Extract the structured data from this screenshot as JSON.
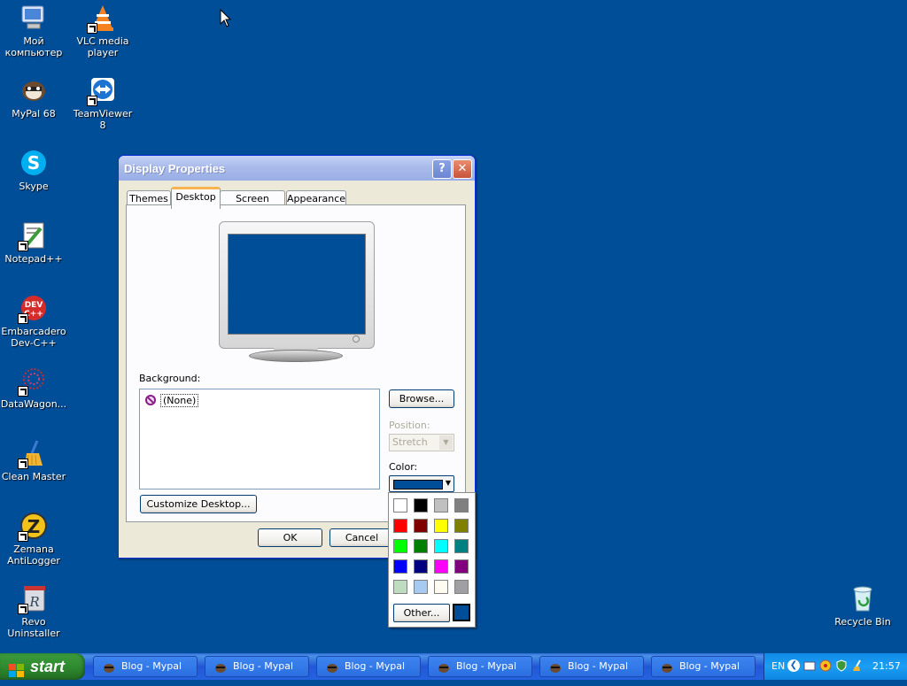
{
  "desktop": {
    "background_color": "#004e98",
    "icons": [
      {
        "label": "Мой компьютер",
        "icon": "my-computer-icon"
      },
      {
        "label": "VLC media player",
        "icon": "vlc-icon"
      },
      {
        "label": "MyPal 68",
        "icon": "mypal-icon"
      },
      {
        "label": "TeamViewer 8",
        "icon": "teamviewer-icon"
      },
      {
        "label": "Skype",
        "icon": "skype-icon"
      },
      {
        "label": "Notepad++",
        "icon": "notepadpp-icon"
      },
      {
        "label": "Embarcadero Dev-C++",
        "icon": "devcpp-icon"
      },
      {
        "label": "DataWagon...",
        "icon": "datawagon-icon"
      },
      {
        "label": "Clean Master",
        "icon": "clean-master-icon"
      },
      {
        "label": "Zemana AntiLogger",
        "icon": "zemana-icon"
      },
      {
        "label": "Revo Uninstaller",
        "icon": "revo-icon"
      },
      {
        "label": "Recycle Bin",
        "icon": "recycle-bin-icon"
      }
    ]
  },
  "dialog": {
    "title": "Display Properties",
    "help_label": "?",
    "close_label": "✕",
    "tabs": [
      {
        "label": "Themes",
        "active": false
      },
      {
        "label": "Desktop",
        "active": true
      },
      {
        "label": "Screen Saver",
        "active": false
      },
      {
        "label": "Appearance",
        "active": false
      }
    ],
    "background_label": "Background:",
    "background_items": [
      {
        "label": "(None)",
        "selected": true
      }
    ],
    "browse_label": "Browse...",
    "position_label": "Position:",
    "position_value": "Stretch",
    "color_label": "Color:",
    "selected_color": "#004e98",
    "customize_label": "Customize Desktop...",
    "ok_label": "OK",
    "cancel_label": "Cancel"
  },
  "color_popup": {
    "palette": [
      "#ffffff",
      "#000000",
      "#c0c0c0",
      "#808080",
      "#ff0000",
      "#800000",
      "#ffff00",
      "#808000",
      "#00ff00",
      "#008000",
      "#00ffff",
      "#008080",
      "#0000ff",
      "#000080",
      "#ff00ff",
      "#800080",
      "#c0dcc0",
      "#a6caf0",
      "#fffbf0",
      "#a0a0a4"
    ],
    "other_label": "Other...",
    "custom_color": "#004e98"
  },
  "taskbar": {
    "start_label": "start",
    "tasks": [
      {
        "label": "Blog - Mypal"
      },
      {
        "label": "Blog - Mypal"
      },
      {
        "label": "Blog - Mypal"
      },
      {
        "label": "Blog - Mypal"
      },
      {
        "label": "Blog - Mypal"
      },
      {
        "label": "Blog - Mypal"
      }
    ],
    "language": "EN",
    "clock": "21:57"
  }
}
